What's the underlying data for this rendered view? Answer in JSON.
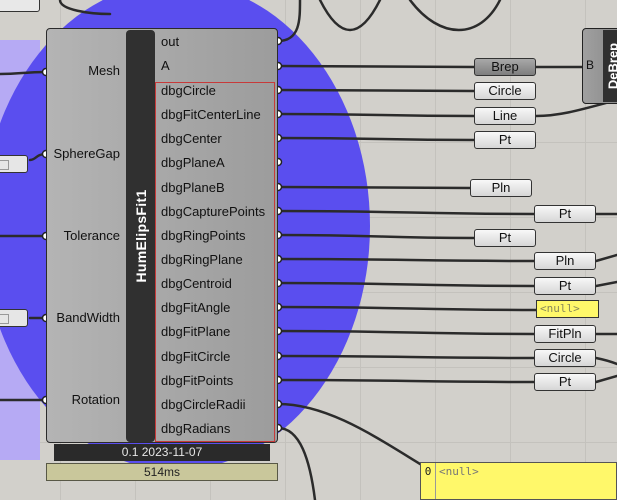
{
  "component": {
    "name": "HumElipsFit1",
    "inputs": [
      "Mesh",
      "SphereGap",
      "Tolerance",
      "BandWidth",
      "Rotation"
    ],
    "outputs": [
      "out",
      "A",
      "dbgCircle",
      "dbgFitCenterLine",
      "dbgCenter",
      "dbgPlaneA",
      "dbgPlaneB",
      "dbgCapturePoints",
      "dbgRingPoints",
      "dbgRingPlane",
      "dbgCentroid",
      "dbgFitAngle",
      "dbgFitPlane",
      "dbgFitCircle",
      "dbgFitPoints",
      "dbgCircleRadii",
      "dbgRadians"
    ],
    "version_label": "0.1 2023-11-07",
    "timer_label": "514ms"
  },
  "params": [
    {
      "label": "Brep",
      "dark": true
    },
    {
      "label": "Circle"
    },
    {
      "label": "Line"
    },
    {
      "label": "Pt"
    },
    {
      "label": "Pln"
    },
    {
      "label": "Pt"
    },
    {
      "label": "Pt"
    },
    {
      "label": "Pln"
    },
    {
      "label": "Pt"
    },
    {
      "label": "<null>",
      "null": true
    },
    {
      "label": "FitPln"
    },
    {
      "label": "Circle"
    },
    {
      "label": "Pt"
    }
  ],
  "right_component": {
    "name": "DeBrep",
    "input": "B"
  },
  "null_panel": {
    "index": "0",
    "value": "<null>"
  },
  "colors": {
    "canvas": "#d2d0cb",
    "circle": "#5a4eef",
    "panel_yellow": "#fff86a",
    "error_red": "#c73a3a"
  }
}
